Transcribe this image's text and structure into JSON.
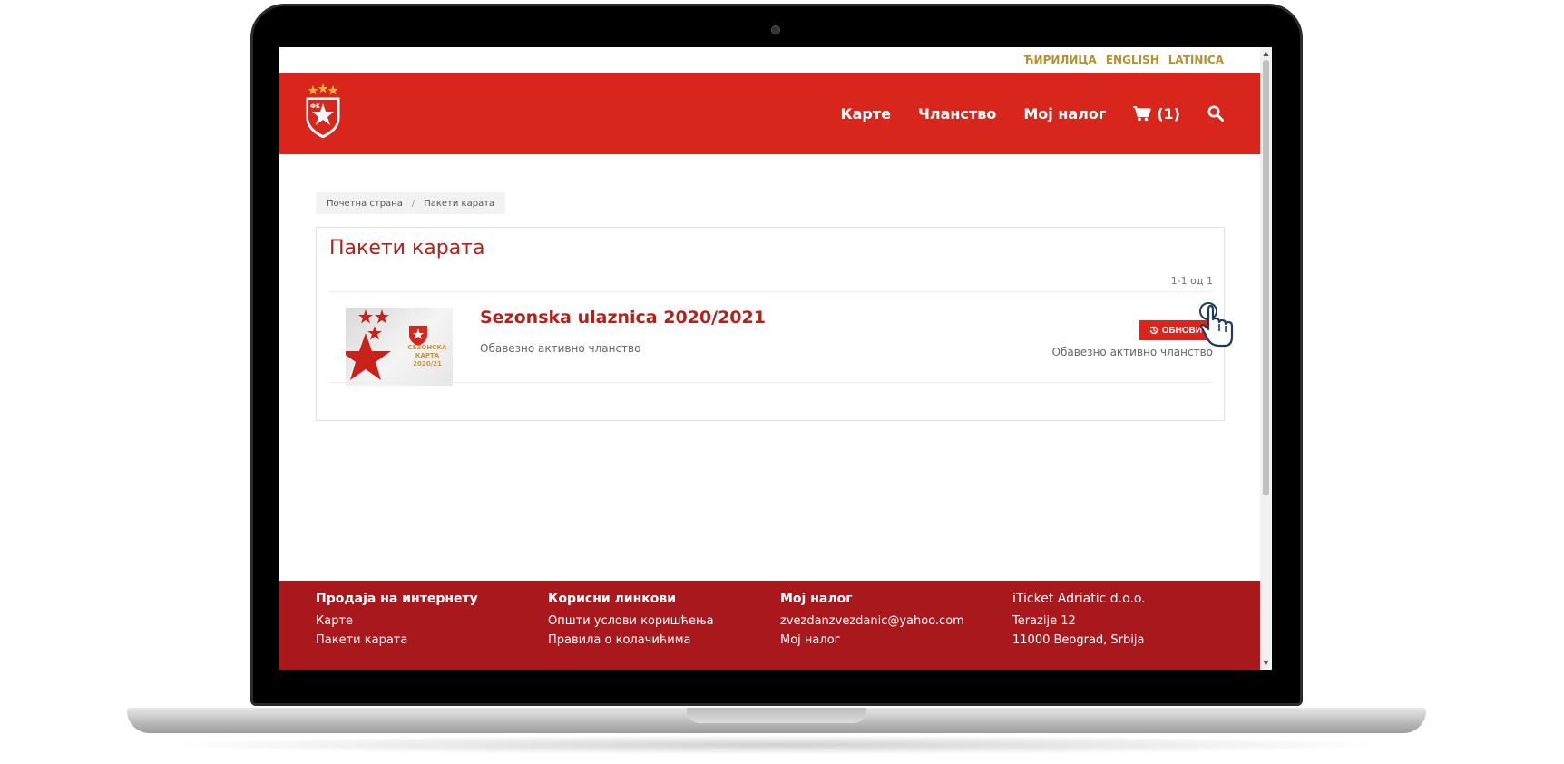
{
  "lang": {
    "cyrillic": "ЋИРИЛИЦА",
    "english": "ENGLISH",
    "latin": "LATINICA"
  },
  "header": {
    "nav": {
      "tickets": "Карте",
      "membership": "Чланство",
      "account": "Мој налог",
      "cart": "(1)"
    }
  },
  "breadcrumb": {
    "home": "Почетна страна",
    "current": "Пакети карата"
  },
  "main": {
    "title": "Пакети карата",
    "pagination": "1-1 од 1",
    "items": [
      {
        "title": "Sezonska ulaznica 2020/2021",
        "description": "Обавезно активно чланство",
        "action_label": "ОБНОВИ",
        "action_note": "Обавезно активно чланство"
      }
    ]
  },
  "footer": {
    "col1": {
      "heading": "Продаја на интернету",
      "links": [
        "Карте",
        "Пакети карата"
      ]
    },
    "col2": {
      "heading": "Корисни линкови",
      "links": [
        "Општи услови коришћења",
        "Правила о колачићима"
      ]
    },
    "col3": {
      "heading": "Мој налог",
      "links": [
        "zvezdanzvezdanic@yahoo.com",
        "Мој налог"
      ]
    },
    "col4": {
      "heading": "iTicket Adriatic d.o.o.",
      "lines": [
        "Terazije 12",
        "11000 Beograd, Srbija"
      ]
    }
  },
  "colors": {
    "brand_red": "#d9261c",
    "footer_red": "#a8181c",
    "lang_gold": "#b8912e"
  }
}
